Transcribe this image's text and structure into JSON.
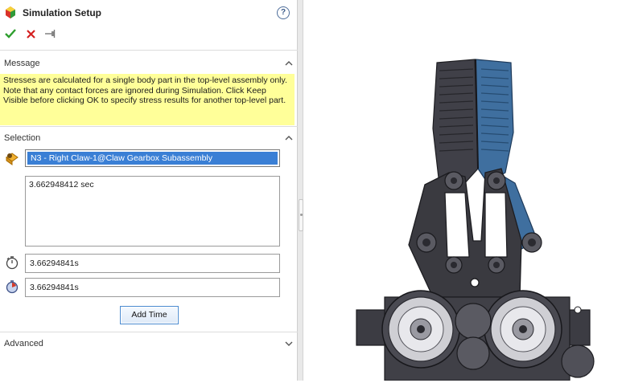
{
  "window": {
    "title": "Simulation Setup",
    "help_label": "?"
  },
  "actions": {
    "ok_icon": "checkmark-icon",
    "cancel_icon": "x-icon",
    "pin_icon": "pushpin-icon"
  },
  "message_section": {
    "header": "Message",
    "text": "Stresses are calculated for a single body part in the top-level assembly only. Note that any contact forces are ignored during Simulation. Click Keep Visible before clicking OK to specify stress results for another top-level part."
  },
  "selection_section": {
    "header": "Selection",
    "selected_part": "N3 - Right Claw-1@Claw Gearbox Subassembly",
    "time_list": [
      "3.662948412 sec"
    ],
    "start_time": "3.66294841s",
    "end_time": "3.66294841s",
    "add_time_label": "Add Time"
  },
  "advanced_section": {
    "header": "Advanced"
  },
  "colors": {
    "message_bg": "#ffff99",
    "selection_highlight": "#3a7fd5",
    "ok_green": "#2e9e2e",
    "cancel_red": "#d42020",
    "part_highlight_blue": "#3f6f9f",
    "model_gray": "#3a3a40"
  }
}
